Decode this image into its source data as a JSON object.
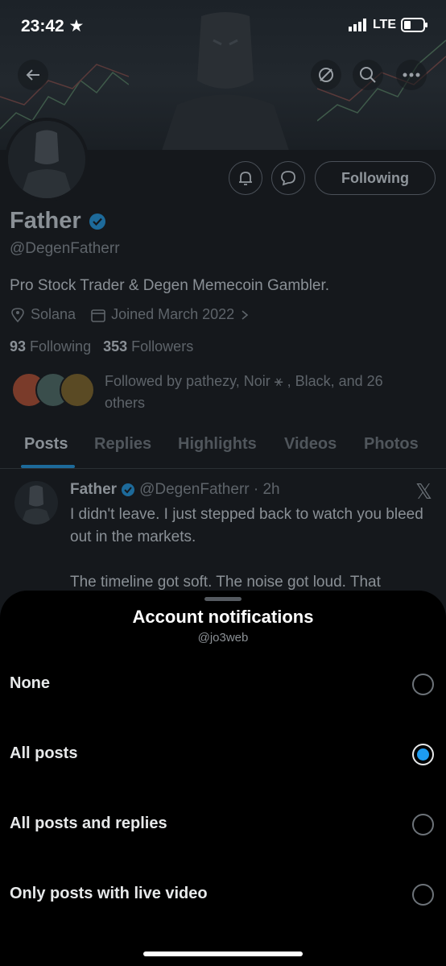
{
  "status_bar": {
    "time": "23:42",
    "network": "LTE"
  },
  "profile": {
    "name": "Father",
    "handle": "@DegenFatherr",
    "bio": "Pro Stock Trader & Degen Memecoin Gambler.",
    "location": "Solana",
    "joined": "Joined March 2022",
    "following_count": "93",
    "following_label": "Following",
    "followers_count": "353",
    "followers_label": "Followers",
    "followed_by": "Followed by pathezy, Noir ⚹ , Black, and 26 others",
    "follow_button": "Following"
  },
  "tabs": [
    "Posts",
    "Replies",
    "Highlights",
    "Videos",
    "Photos"
  ],
  "post": {
    "author": "Father",
    "handle_time": "@DegenFatherr · 2h",
    "line1": "I didn't leave. I just stepped back to watch you bleed out in the markets.",
    "line2": "The timeline got soft. The noise got loud. That"
  },
  "sheet": {
    "title": "Account notifications",
    "subtitle": "@jo3web",
    "options": [
      {
        "label": "None",
        "selected": false
      },
      {
        "label": "All posts",
        "selected": true
      },
      {
        "label": "All posts and replies",
        "selected": false
      },
      {
        "label": "Only posts with live video",
        "selected": false
      }
    ]
  },
  "colors": {
    "accent": "#1d9bf0",
    "sheet_bg": "#000000",
    "text": "#e7e9ea"
  }
}
